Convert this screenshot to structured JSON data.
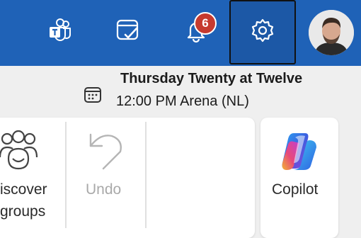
{
  "header": {
    "notification_count": "6",
    "colors": {
      "bar": "#1f62b7",
      "badge": "#c63a2f"
    },
    "icons": [
      "teams-icon",
      "todo-icon",
      "bell-icon",
      "gear-icon",
      "avatar"
    ]
  },
  "meeting": {
    "title": "Thursday Twenty at Twelve",
    "time": "12:00 PM",
    "location": "Arena (NL)"
  },
  "ribbon": {
    "discover_line1": "iscover",
    "discover_line2": "groups",
    "undo_label": "Undo",
    "copilot_label": "Copilot"
  }
}
